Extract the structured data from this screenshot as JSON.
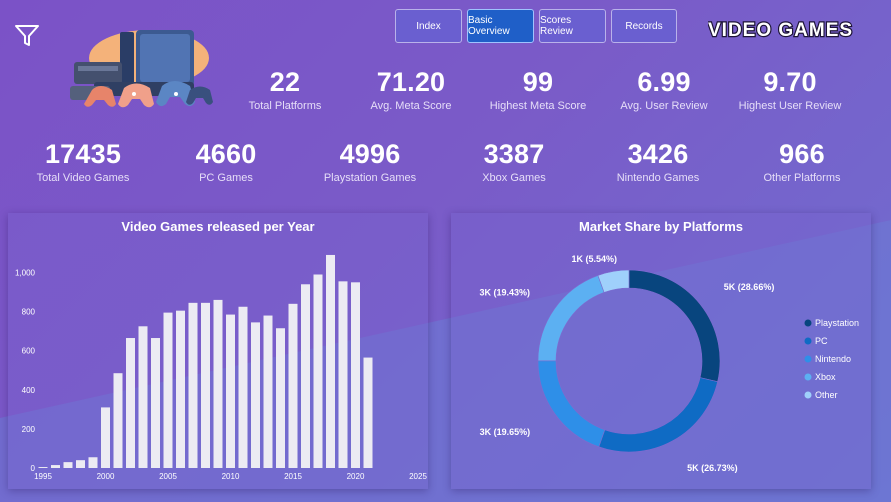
{
  "nav": {
    "buttons": [
      {
        "label": "Index",
        "active": false
      },
      {
        "label": "Basic Overview",
        "active": true
      },
      {
        "label": "Scores Review",
        "active": false
      },
      {
        "label": "Records",
        "active": false
      }
    ]
  },
  "logo_text": "VIDEO GAMES",
  "kpis_top": [
    {
      "value": "22",
      "label": "Total Platforms"
    },
    {
      "value": "71.20",
      "label": "Avg. Meta Score"
    },
    {
      "value": "99",
      "label": "Highest Meta Score"
    },
    {
      "value": "6.99",
      "label": "Avg. User Review"
    },
    {
      "value": "9.70",
      "label": "Highest User Review"
    }
  ],
  "kpis_bottom": [
    {
      "value": "17435",
      "label": "Total Video Games"
    },
    {
      "value": "4660",
      "label": "PC Games"
    },
    {
      "value": "4996",
      "label": "Playstation Games"
    },
    {
      "value": "3387",
      "label": "Xbox Games"
    },
    {
      "value": "3426",
      "label": "Nintendo Games"
    },
    {
      "value": "966",
      "label": "Other Platforms"
    }
  ],
  "colors": {
    "accent_active": "#1f5fc8",
    "bar": "#ecebf3",
    "playstation": "#08457e",
    "pc": "#0f6bc4",
    "nintendo": "#2e8fe8",
    "xbox": "#5cb0f2",
    "other": "#9fd0fb"
  },
  "chart_data": [
    {
      "type": "bar",
      "title": "Video Games released per Year",
      "x": [
        1995,
        1996,
        1997,
        1998,
        1999,
        2000,
        2001,
        2002,
        2003,
        2004,
        2005,
        2006,
        2007,
        2008,
        2009,
        2010,
        2011,
        2012,
        2013,
        2014,
        2015,
        2016,
        2017,
        2018,
        2019,
        2020,
        2021
      ],
      "values": [
        5,
        15,
        30,
        40,
        55,
        310,
        485,
        665,
        725,
        665,
        795,
        805,
        845,
        845,
        860,
        785,
        825,
        745,
        780,
        715,
        840,
        940,
        990,
        1090,
        955,
        950,
        565
      ],
      "xticks": [
        "1995",
        "2000",
        "2005",
        "2010",
        "2015",
        "2020",
        "2025"
      ],
      "yticks": [
        "0",
        "200",
        "400",
        "600",
        "800",
        "1,000"
      ],
      "xlim": [
        1995,
        2025
      ],
      "ylim": [
        0,
        1100
      ],
      "grid": false
    },
    {
      "type": "pie",
      "title": "Market Share by Platforms",
      "labels": [
        "Playstation",
        "PC",
        "Nintendo",
        "Xbox",
        "Other"
      ],
      "values": [
        28.66,
        26.73,
        19.65,
        19.43,
        5.54
      ],
      "data_labels": [
        "5K (28.66%)",
        "5K (26.73%)",
        "3K (19.65%)",
        "3K (19.43%)",
        "1K (5.54%)"
      ],
      "legend": "right"
    }
  ]
}
